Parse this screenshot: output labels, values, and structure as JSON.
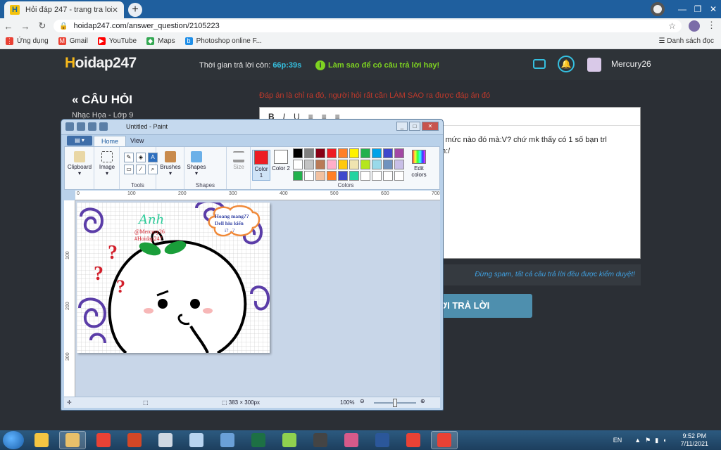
{
  "browser": {
    "tab_title": "Hỏi đáp 247 - trang tra loi",
    "tab_favicon": "H",
    "url": "hoidap247.com/answer_question/2105223",
    "bookmarks": [
      {
        "label": "Ứng dụng",
        "icon": "apps-grid-icon",
        "color": "#e94235"
      },
      {
        "label": "Gmail",
        "icon": "gmail-icon",
        "color": "#ea4335"
      },
      {
        "label": "YouTube",
        "icon": "youtube-icon",
        "color": "#ff0000"
      },
      {
        "label": "Maps",
        "icon": "maps-icon",
        "color": "#34a853"
      },
      {
        "label": "Photoshop online F...",
        "icon": "photoshop-icon",
        "color": "#1f8fe8"
      }
    ],
    "reading_list": "Danh sách đọc"
  },
  "site": {
    "logo_letter": "H",
    "logo_rest": "oidap247",
    "timer_label": "Thời gian trả lời còn:",
    "timer_value": "66p:39s",
    "howto": "Làm sao để có câu trả lời hay!",
    "username": "Mercury26",
    "section_title": "« CÂU HỎI",
    "subject": "Nhạc Họa - Lớp 9",
    "warn_top": "Đáp án là chỉ ra đó, người hỏi rất cần LÀM SAO ra được đáp án đó",
    "editor_line1": "i mức nào đó mà:V? chứ mk thấy có 1 số bạn trl",
    "editor_line2": "n:/",
    "warn_bottom": "Đừng spam, tất cả câu trả lời đều được kiểm duyệt!",
    "submit": "ỜI TRẢ LỜI",
    "accent": "#35c0e0"
  },
  "paint": {
    "title": "Untitled - Paint",
    "tabs": [
      "Home",
      "View"
    ],
    "groups": {
      "clipboard": "Clipboard",
      "image": "Image",
      "tools": "Tools",
      "brushes": "Brushes",
      "shapes": "Shapes",
      "size": "Size",
      "color1": "Color 1",
      "color2": "Color 2",
      "colors": "Colors",
      "edit_colors": "Edit colors"
    },
    "palette": [
      "#000000",
      "#7f7f7f",
      "#880015",
      "#ed1c24",
      "#ff7f27",
      "#fff200",
      "#22b14c",
      "#00a2e8",
      "#3f48cc",
      "#a349a4",
      "#ffffff",
      "#c3c3c3",
      "#b97a57",
      "#ffaec9",
      "#ffc90e",
      "#efe4b0",
      "#b5e61d",
      "#99d9ea",
      "#7092be",
      "#c8bfe7",
      "#22b14c",
      "#ffffff",
      "#f2c1a0",
      "#ff7f27",
      "#3f48cc",
      "#22d4a0",
      "#ffffff",
      "#ffffff",
      "#ffffff",
      "#ffffff"
    ],
    "color1": "#ed1c24",
    "color2": "#ffffff",
    "ruler_h": [
      "0",
      "100",
      "200",
      "300",
      "400",
      "500",
      "600",
      "700"
    ],
    "ruler_v": [
      "100",
      "200",
      "300"
    ],
    "status_size": "383 × 300px",
    "zoom": "100%",
    "drawing": {
      "signature": "Anh",
      "credit1": "@Mercury26",
      "credit2": "#Hoidap247",
      "bubble_line1": "Hoang mang??",
      "bubble_line2": "Dell hiu kiến",
      "bubble_line3": "i? . ?"
    }
  },
  "taskbar": {
    "lang": "EN",
    "time": "9:52 PM",
    "date": "7/11/2021",
    "apps": [
      {
        "name": "file-explorer-icon",
        "color": "#f4c542"
      },
      {
        "name": "paint-icon",
        "color": "#e8c06a"
      },
      {
        "name": "chrome-icon",
        "color": "#e94235"
      },
      {
        "name": "powerpoint-icon",
        "color": "#d24726"
      },
      {
        "name": "app-grid-icon",
        "color": "#cfd8e3"
      },
      {
        "name": "notepad-icon",
        "color": "#b8d4f0"
      },
      {
        "name": "network-icon",
        "color": "#6aa0d8"
      },
      {
        "name": "excel-icon",
        "color": "#1d7044"
      },
      {
        "name": "sync-icon",
        "color": "#8fd14f"
      },
      {
        "name": "microphone-icon",
        "color": "#444"
      },
      {
        "name": "snip-icon",
        "color": "#d65a8a"
      },
      {
        "name": "word-icon",
        "color": "#2b579a"
      },
      {
        "name": "chrome-icon",
        "color": "#e94235"
      },
      {
        "name": "chrome-icon",
        "color": "#e94235"
      }
    ]
  }
}
